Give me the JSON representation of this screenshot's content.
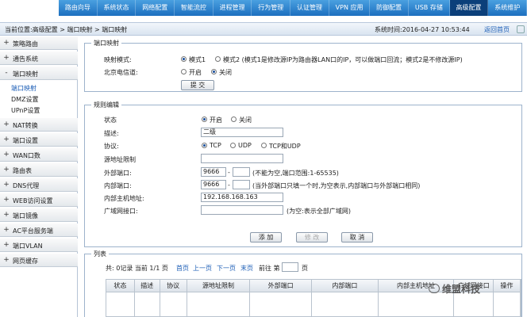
{
  "nav": {
    "items": [
      "路由向导",
      "系统状态",
      "网络配置",
      "智能流控",
      "进程管理",
      "行为管理",
      "认证管理",
      "VPN 应用",
      "防御配置",
      "USB 存储",
      "高级配置",
      "系统维护"
    ],
    "active_index": 10
  },
  "breadcrumb": "当前位置:高级配置 > 端口映射 > 端口映射",
  "system_time": "系统时间:2016-04-27 10:53:44",
  "home_link": "返回首页",
  "sidebar": {
    "items": [
      {
        "label": "策略路由",
        "state": "+"
      },
      {
        "label": "通告系统",
        "state": "+"
      },
      {
        "label": "端口映射",
        "state": "-"
      },
      {
        "label": "NAT转换",
        "state": "+"
      },
      {
        "label": "端口设置",
        "state": "+"
      },
      {
        "label": "WAN口数",
        "state": "+"
      },
      {
        "label": "路由表",
        "state": "+"
      },
      {
        "label": "DNS代理",
        "state": "+"
      },
      {
        "label": "WEB访问设置",
        "state": "+"
      },
      {
        "label": "端口镜像",
        "state": "+"
      },
      {
        "label": "AC平台服务端",
        "state": "+"
      },
      {
        "label": "端口VLAN",
        "state": "+"
      },
      {
        "label": "网页缓存",
        "state": "+"
      }
    ],
    "subitems": [
      "端口映射",
      "DMZ设置",
      "UPnP设置"
    ]
  },
  "port_map": {
    "legend": "端口映射",
    "mode_label": "映射模式:",
    "mode1": "模式1",
    "mode2": "模式2 (模式1是修改源IP为路由器LAN口的IP，可以做端口回流；模式2是不修改源IP)",
    "telecom_label": "北京电信道:",
    "on": "开启",
    "off": "关闭",
    "submit": "提 交"
  },
  "rule_edit": {
    "legend": "规则编辑",
    "status_label": "状态",
    "status_on": "开启",
    "status_off": "关闭",
    "desc_label": "描述:",
    "desc_value": "二级",
    "protocol_label": "协议:",
    "protocols": [
      "TCP",
      "UDP",
      "TCP和UDP"
    ],
    "src_limit_label": "源地址限制",
    "ext_port_label": "外部端口:",
    "ext_port_from": "9666",
    "ext_port_hint": "(不能为空,端口范围:1-65535)",
    "int_port_label": "内部端口:",
    "int_port_from": "9666",
    "int_port_hint": "(当外部端口只填一个时,为空表示,内部端口与外部端口相同)",
    "host_label": "内部主机地址:",
    "host_value": "192.168.168.163",
    "wan_label": "广域网接口:",
    "wan_hint": "(为空:表示全部广域网)",
    "add": "添 加",
    "modify": "修 改",
    "cancel": "取 消"
  },
  "list": {
    "legend": "列表",
    "pager_text": "共: 0记录 当前 1/1 页",
    "first": "首页",
    "prev": "上一页",
    "next": "下一页",
    "last": "末页",
    "goto_label": "前往 第",
    "page_suffix": "页",
    "columns": [
      "状态",
      "描述",
      "协议",
      "源地址限制",
      "外部端口",
      "内部端口",
      "内部主机地址",
      "广域网接口",
      "操作"
    ]
  },
  "watermark": "维盟科技"
}
